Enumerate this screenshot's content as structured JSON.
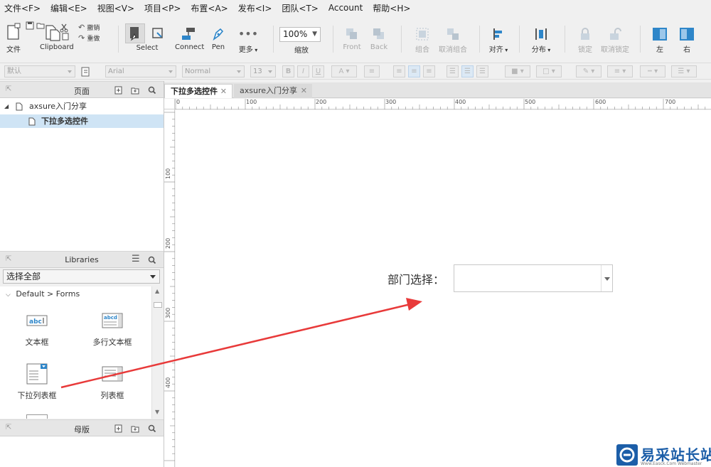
{
  "menu": [
    "文件<F>",
    "编辑<E>",
    "视图<V>",
    "项目<P>",
    "布置<A>",
    "发布<I>",
    "团队<T>",
    "Account",
    "帮助<H>"
  ],
  "toolbar": {
    "file": "文件",
    "clipboard": "Clipboard",
    "undo": "撤销",
    "redo": "重做",
    "select": "Select",
    "connect": "Connect",
    "pen": "Pen",
    "more": "更多",
    "zoom_value": "100%",
    "zoom": "缩放",
    "front": "Front",
    "back": "Back",
    "group": "组合",
    "ungroup": "取消组合",
    "align": "对齐",
    "distribute": "分布",
    "lock": "锁定",
    "unlock": "取消锁定",
    "left": "左",
    "right": "右"
  },
  "format": {
    "style": "默认",
    "font": "Arial",
    "weight": "Normal",
    "size": "13",
    "bold": "B",
    "italic": "I",
    "underline": "U",
    "font_color": "A"
  },
  "pages_panel": {
    "title": "页面",
    "items": [
      {
        "label": "axsure入门分享"
      },
      {
        "label": "下拉多选控件"
      }
    ]
  },
  "libraries_panel": {
    "title": "Libraries",
    "select_value": "选择全部",
    "group": "Default > Forms",
    "widgets": [
      {
        "label": "文本框"
      },
      {
        "label": "多行文本框"
      },
      {
        "label": "下拉列表框"
      },
      {
        "label": "列表框"
      }
    ]
  },
  "masters_panel": {
    "title": "母版"
  },
  "tabs": [
    {
      "label": "下拉多选控件"
    },
    {
      "label": "axsure入门分享"
    }
  ],
  "ruler": {
    "h": [
      "0",
      "100",
      "200",
      "300",
      "400",
      "500",
      "600",
      "700"
    ],
    "v": [
      "100",
      "200",
      "300",
      "400"
    ]
  },
  "canvas": {
    "field_label": "部门选择：",
    "dropdown_value": ""
  },
  "colors": {
    "accent": "#2e86c9",
    "arrow": "#e83a3a",
    "selection": "#cfe4f5"
  },
  "watermark": {
    "title": "易采站长站",
    "subtitle": "Www.Easck.Com Webmaster"
  }
}
